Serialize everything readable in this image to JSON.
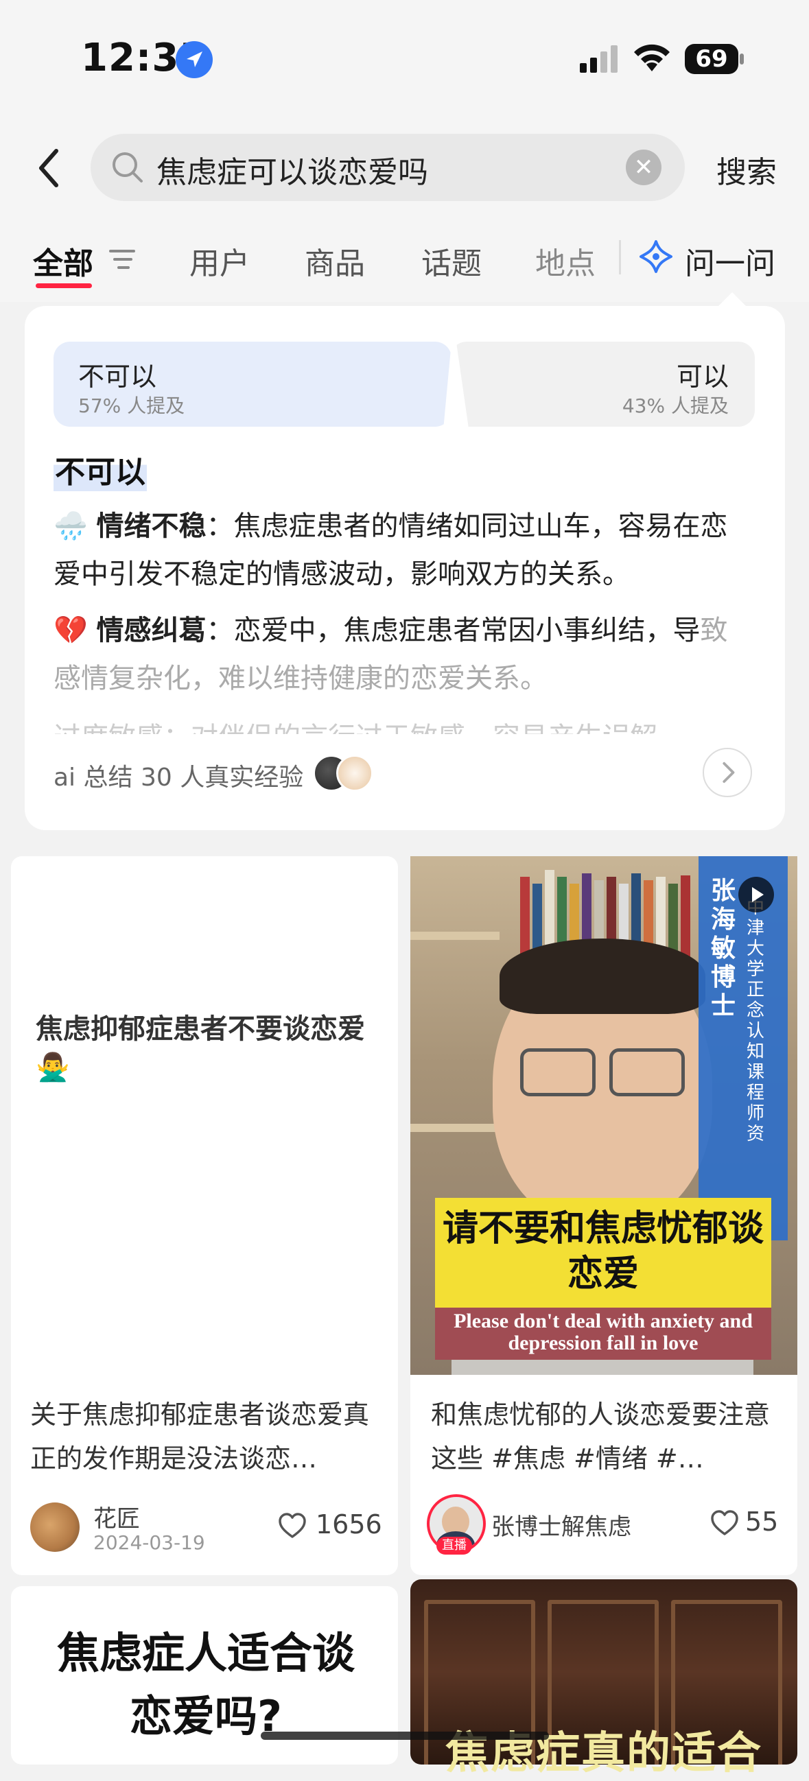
{
  "status_bar": {
    "time": "12:35",
    "battery": "69"
  },
  "search": {
    "query": "焦虑症可以谈恋爱吗",
    "button": "搜索"
  },
  "tabs": [
    {
      "label": "全部",
      "active": true
    },
    {
      "label": "用户"
    },
    {
      "label": "商品"
    },
    {
      "label": "话题"
    },
    {
      "label": "地点"
    },
    {
      "label": "问一问"
    }
  ],
  "ai_card": {
    "options": [
      {
        "label": "不可以",
        "percent_text": "57% 人提及",
        "selected": true
      },
      {
        "label": "可以",
        "percent_text": "43% 人提及"
      }
    ],
    "answer_heading": "不可以",
    "points": [
      {
        "emoji": "🌧️",
        "title": "情绪不稳",
        "text": "：焦虑症患者的情绪如同过山车，容易在恋爱中引发不稳定的情感波动，影响双方的关系。"
      },
      {
        "emoji": "💔",
        "title": "情感纠葛",
        "text_main": "：恋爱中，焦虑症患者常因小事纠结，导",
        "text_fade": "致感情复杂化，难以维持健康的恋爱关系。"
      },
      {
        "text": "过度敏感：对伴侣的言行过于敏感，容易产生误解"
      }
    ],
    "footer": "ai 总结 30 人真实经验"
  },
  "feed": [
    {
      "cover_text": "焦虑抑郁症患者不要谈恋爱🙅‍♂️",
      "caption": "关于焦虑抑郁症患者谈恋爱真正的发作期是没法谈恋…",
      "author": "花匠",
      "date": "2024-03-19",
      "likes": "1656"
    },
    {
      "cover_title": "请不要和焦虑忧郁谈恋爱",
      "cover_subtitle": "Please don't deal with anxiety and depression fall in love",
      "vertical_name": "张海敏博士",
      "vertical_sub": "中津大学正念认知课程师资",
      "caption": "和焦虑忧郁的人谈恋爱要注意这些 #焦虑 #情绪 #…",
      "author": "张博士解焦虑",
      "live_badge": "直播",
      "likes": "55"
    },
    {
      "cover_title": "焦虑症人适合谈恋爱吗?"
    },
    {
      "cover_title": "焦虑症真的适合"
    }
  ],
  "colors": {
    "accent": "#ff2442",
    "ai_blue": "#3478f6",
    "option_selected_bg": "#e6edfb"
  }
}
